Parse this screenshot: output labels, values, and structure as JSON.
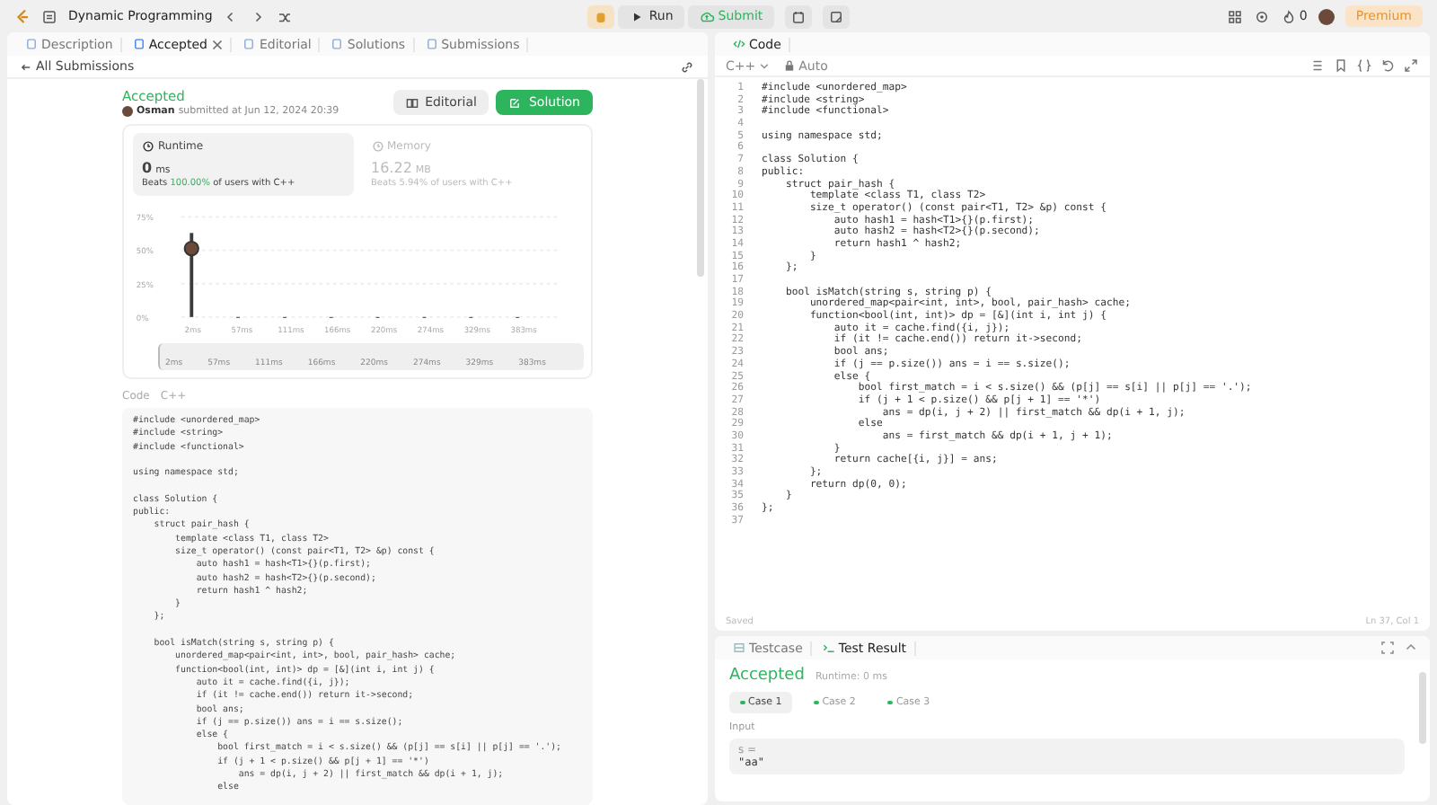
{
  "topbar": {
    "title": "Dynamic Programming",
    "run": "Run",
    "submit": "Submit",
    "streak": "0",
    "premium": "Premium"
  },
  "left": {
    "tabs": [
      {
        "label": "Description",
        "selected": false,
        "closable": false
      },
      {
        "label": "Accepted",
        "selected": true,
        "closable": true
      },
      {
        "label": "Editorial",
        "selected": false,
        "closable": false
      },
      {
        "label": "Solutions",
        "selected": false,
        "closable": false
      },
      {
        "label": "Submissions",
        "selected": false,
        "closable": false
      }
    ],
    "back": "All Submissions",
    "status": "Accepted",
    "user": "Osman",
    "submitted": "submitted at Jun 12, 2024 20:39",
    "buttons": [
      "Editorial",
      "Solution"
    ],
    "stats": [
      {
        "label": "Runtime",
        "value": "0",
        "unit": "ms",
        "beats": "Beats",
        "pct": "100.00%",
        "rest": "of users with C++",
        "selected": true
      },
      {
        "label": "Memory",
        "value": "16.22",
        "unit": "MB",
        "beats": "Beats",
        "pct": "5.94%",
        "rest": "of users with C++",
        "selected": false
      }
    ],
    "chart_data": {
      "type": "bar",
      "categories": [
        "2ms",
        "57ms",
        "111ms",
        "166ms",
        "220ms",
        "274ms",
        "329ms",
        "383ms"
      ],
      "series": [
        {
          "color": "#3c3c3c",
          "values": [
            63,
            0,
            0,
            0,
            0,
            0,
            0,
            0
          ]
        }
      ],
      "ylim": [
        0,
        75
      ],
      "yticks": [
        {
          "value": 0,
          "label": "0%"
        },
        {
          "value": 25,
          "label": "25%"
        },
        {
          "value": 50,
          "label": "50%"
        },
        {
          "value": 75,
          "label": "75%"
        }
      ]
    },
    "range": {
      "level": 1,
      "labels": [
        "2ms",
        "57ms",
        "111ms",
        "166ms",
        "220ms",
        "274ms",
        "329ms",
        "383ms"
      ]
    },
    "code_label": "Code",
    "code_lang": "C++",
    "code_blocks": [
      [
        "#include <unordered_map>",
        "#include <string>",
        "#include <functional>"
      ],
      [
        "using namespace std;"
      ],
      [
        "class Solution {",
        "public:",
        "    struct pair_hash {",
        "        template <class T1, class T2>",
        "        size_t operator() (const pair<T1, T2> &p) const {",
        "            auto hash1 = hash<T1>{}(p.first);",
        "            auto hash2 = hash<T2>{}(p.second);",
        "            return hash1 ^ hash2;",
        "        }",
        "    };"
      ],
      [
        "    bool isMatch(string s, string p) {",
        "        unordered_map<pair<int, int>, bool, pair_hash> cache;",
        "        function<bool(int, int)> dp = [&](int i, int j) {",
        "            auto it = cache.find({i, j});",
        "            if (it != cache.end()) return it->second;",
        "            bool ans;",
        "            if (j == p.size()) ans = i == s.size();",
        "            else {",
        "                bool first_match = i < s.size() && (p[j] == s[i] || p[j] == '.');",
        "                if (j + 1 < p.size() && p[j + 1] == '*')",
        "                    ans = dp(i, j + 2) || first_match && dp(i + 1, j);",
        "                else"
      ]
    ]
  },
  "right": {
    "code_title": "Code",
    "lang": "C++",
    "mode": "Auto",
    "lines": [
      {
        "n": "1",
        "text": "#include <unordered_map>"
      },
      {
        "n": "2",
        "text": "#include <string>"
      },
      {
        "n": "3",
        "text": "#include <functional>"
      },
      {
        "n": "4"
      },
      {
        "n": "5",
        "text": "using namespace std;"
      },
      {
        "n": "6"
      },
      {
        "n": "7",
        "text": "class Solution {"
      },
      {
        "n": "8",
        "text": "public:"
      },
      {
        "n": "9",
        "text": "    struct pair_hash {"
      },
      {
        "n": "10",
        "text": "        template <class T1, class T2>"
      },
      {
        "n": "11",
        "text": "        size_t operator() (const pair<T1, T2> &p) const {"
      },
      {
        "n": "12",
        "text": "            auto hash1 = hash<T1>{}(p.first);"
      },
      {
        "n": "13",
        "text": "            auto hash2 = hash<T2>{}(p.second);"
      },
      {
        "n": "14",
        "text": "            return hash1 ^ hash2;"
      },
      {
        "n": "15",
        "text": "        }"
      },
      {
        "n": "16",
        "text": "    };"
      },
      {
        "n": "17"
      },
      {
        "n": "18",
        "text": "    bool isMatch(string s, string p) {"
      },
      {
        "n": "19",
        "text": "        unordered_map<pair<int, int>, bool, pair_hash> cache;"
      },
      {
        "n": "20",
        "text": "        function<bool(int, int)> dp = [&](int i, int j) {"
      },
      {
        "n": "21",
        "text": "            auto it = cache.find({i, j});"
      },
      {
        "n": "22",
        "text": "            if (it != cache.end()) return it->second;"
      },
      {
        "n": "23",
        "text": "            bool ans;"
      },
      {
        "n": "24",
        "text": "            if (j == p.size()) ans = i == s.size();"
      },
      {
        "n": "25",
        "text": "            else {"
      },
      {
        "n": "26",
        "text": "                bool first_match = i < s.size() && (p[j] == s[i] || p[j] == '.');"
      },
      {
        "n": "27",
        "text": "                if (j + 1 < p.size() && p[j + 1] == '*')"
      },
      {
        "n": "28",
        "text": "                    ans = dp(i, j + 2) || first_match && dp(i + 1, j);"
      },
      {
        "n": "29",
        "text": "                else"
      },
      {
        "n": "30",
        "text": "                    ans = first_match && dp(i + 1, j + 1);"
      },
      {
        "n": "31",
        "text": "            }"
      },
      {
        "n": "32",
        "text": "            return cache[{i, j}] = ans;"
      },
      {
        "n": "33",
        "text": "        };"
      },
      {
        "n": "34",
        "text": "        return dp(0, 0);"
      },
      {
        "n": "35",
        "text": "    }"
      },
      {
        "n": "36",
        "text": "};"
      },
      {
        "n": "37"
      }
    ],
    "saved": "Saved",
    "cursor": "Ln 37, Col 1",
    "test_tabs": [
      {
        "label": "Testcase",
        "selected": false
      },
      {
        "label": "Test Result",
        "selected": true
      }
    ],
    "result": "Accepted",
    "runtime": "Runtime: 0 ms",
    "cases": [
      {
        "label": "Case 1",
        "selected": true,
        "passed": true
      },
      {
        "label": "Case 2",
        "selected": false,
        "passed": true
      },
      {
        "label": "Case 3",
        "selected": false,
        "passed": true
      }
    ],
    "input_label": "Input",
    "inputs": [
      {
        "name": "s =",
        "value": "\"aa\""
      }
    ]
  }
}
